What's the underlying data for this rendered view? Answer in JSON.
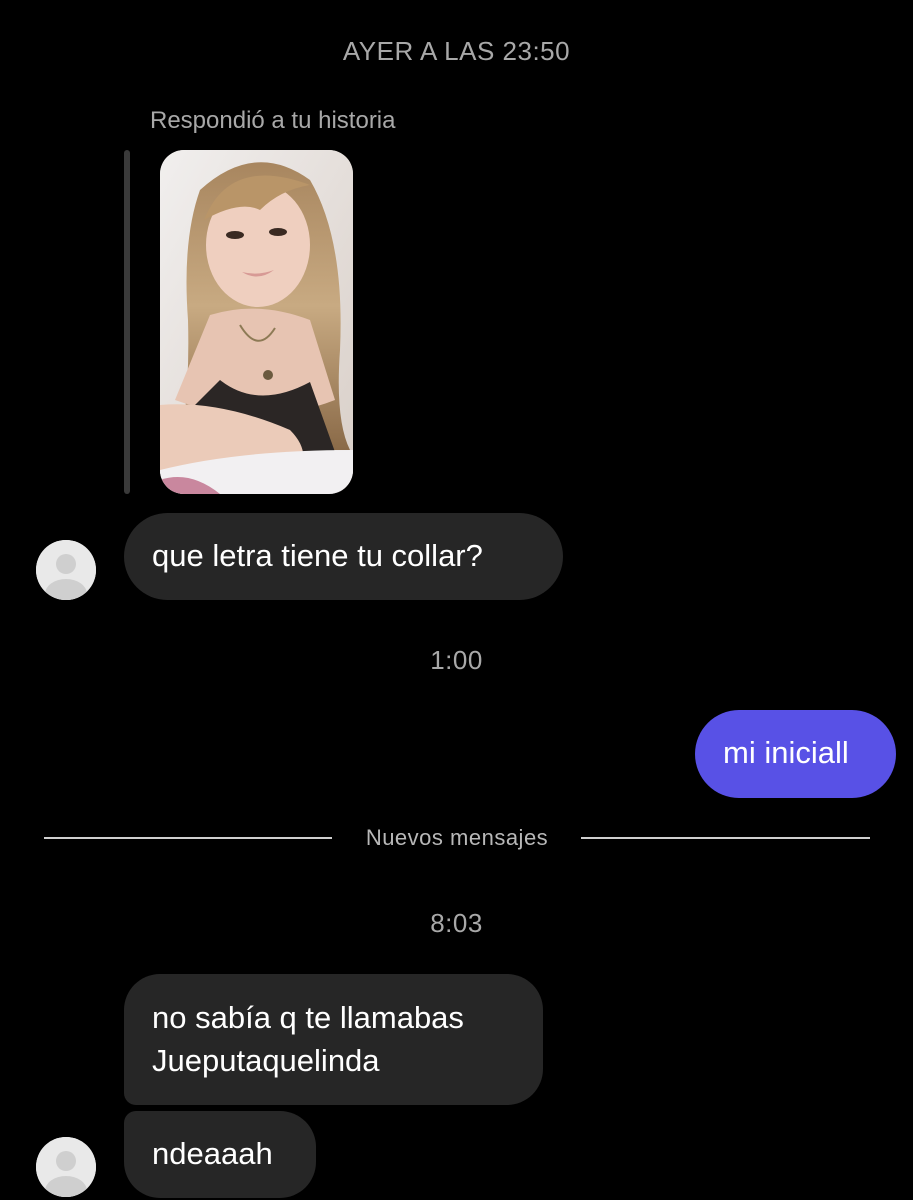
{
  "thread": {
    "timestamps": [
      "AYER A LAS 23:50",
      "1:00",
      "8:03"
    ],
    "story_reply_label": "Respondió a tu historia",
    "new_messages_label": "Nuevos mensajes",
    "messages": [
      {
        "sender": "them",
        "text": "que letra tiene tu collar?"
      },
      {
        "sender": "me",
        "text": "mi iniciall"
      },
      {
        "sender": "them",
        "text": "no sabía q te llamabas\nJueputaquelinda"
      },
      {
        "sender": "them",
        "text": "ndeaaah"
      }
    ]
  },
  "colors": {
    "background": "#000000",
    "incoming_bubble": "#262626",
    "outgoing_bubble": "#5851e6",
    "muted_text": "#a8a8a8"
  },
  "icons": {
    "avatar": "default-avatar-icon",
    "story": "story-thumbnail-image"
  }
}
